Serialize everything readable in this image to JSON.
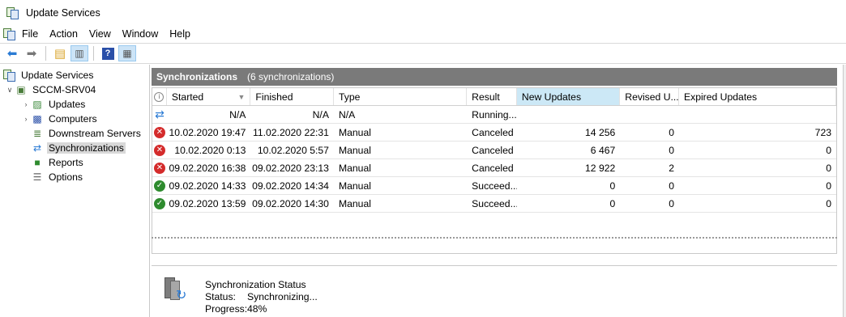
{
  "window": {
    "title": "Update Services"
  },
  "menu": [
    "File",
    "Action",
    "View",
    "Window",
    "Help"
  ],
  "tree": {
    "root": "Update Services",
    "server": "SCCM-SRV04",
    "children": [
      "Updates",
      "Computers",
      "Downstream Servers",
      "Synchronizations",
      "Reports",
      "Options"
    ]
  },
  "panel": {
    "title": "Synchronizations",
    "count": "(6 synchronizations)"
  },
  "grid": {
    "columns": [
      "Started",
      "Finished",
      "Type",
      "Result",
      "New Updates",
      "Revised U...",
      "Expired Updates"
    ],
    "rows": [
      {
        "status": "running",
        "started": "N/A",
        "finished": "N/A",
        "type": "N/A",
        "result": "Running...",
        "new": "",
        "revised": "",
        "expired": ""
      },
      {
        "status": "failed",
        "started": "10.02.2020 19:47",
        "finished": "11.02.2020 22:31",
        "type": "Manual",
        "result": "Canceled",
        "new": "14 256",
        "revised": "0",
        "expired": "723"
      },
      {
        "status": "failed",
        "started": "10.02.2020 0:13",
        "finished": "10.02.2020 5:57",
        "type": "Manual",
        "result": "Canceled",
        "new": "6 467",
        "revised": "0",
        "expired": "0"
      },
      {
        "status": "failed",
        "started": "09.02.2020 16:38",
        "finished": "09.02.2020 23:13",
        "type": "Manual",
        "result": "Canceled",
        "new": "12 922",
        "revised": "2",
        "expired": "0"
      },
      {
        "status": "succeeded",
        "started": "09.02.2020 14:33",
        "finished": "09.02.2020 14:34",
        "type": "Manual",
        "result": "Succeed...",
        "new": "0",
        "revised": "0",
        "expired": "0"
      },
      {
        "status": "succeeded",
        "started": "09.02.2020 13:59",
        "finished": "09.02.2020 14:30",
        "type": "Manual",
        "result": "Succeed...",
        "new": "0",
        "revised": "0",
        "expired": "0"
      }
    ]
  },
  "detail": {
    "heading": "Synchronization Status",
    "status_label": "Status:",
    "status_value": "Synchronizing...",
    "progress_label": "Progress:",
    "progress_value": "48%"
  },
  "icons": {
    "back": "back-arrow-icon",
    "forward": "forward-arrow-icon",
    "folder": "folder-up-icon",
    "console": "show-hide-console-tree-icon",
    "help": "help-icon",
    "action_pane": "show-hide-action-pane-icon"
  },
  "colors": {
    "failed": "#d42b2b",
    "succeeded": "#2e8b2e",
    "running": "#2b7bd4",
    "header": "#7a7a7a",
    "highlight": "#cce8f6"
  }
}
